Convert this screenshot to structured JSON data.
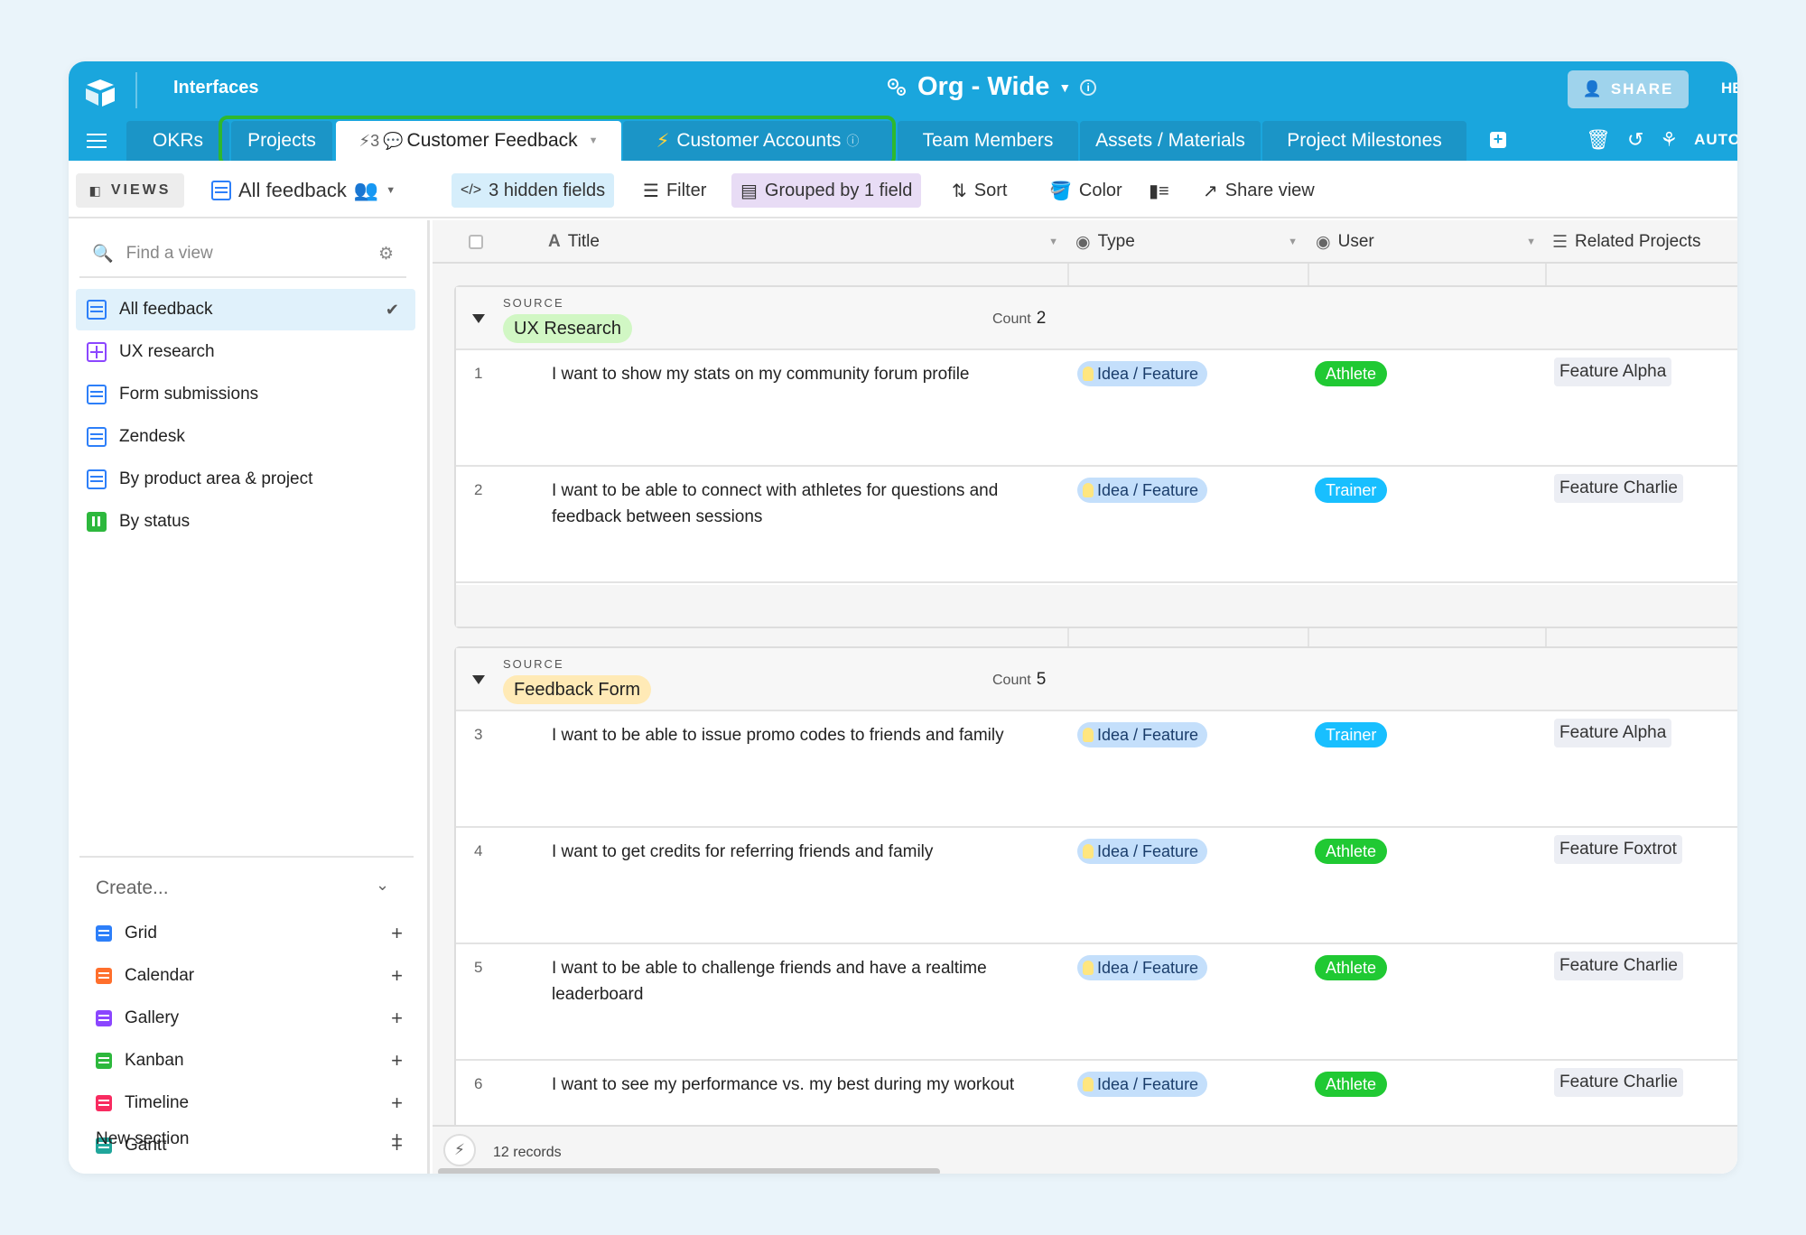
{
  "topbar": {
    "interfaces_label": "Interfaces",
    "base_title": "Org - Wide",
    "share_label": "SHARE",
    "help_label": "HE",
    "autom_label": "AUTOM"
  },
  "tabs": [
    {
      "label": "OKRs"
    },
    {
      "label": "Projects"
    },
    {
      "label": "Customer Feedback",
      "prefix": "⚡3",
      "active": true
    },
    {
      "label": "Customer Accounts"
    },
    {
      "label": "Team Members"
    },
    {
      "label": "Assets / Materials"
    },
    {
      "label": "Project Milestones"
    }
  ],
  "toolbar": {
    "views_label": "VIEWS",
    "current_view": "All feedback",
    "hidden_fields": "3 hidden fields",
    "filter": "Filter",
    "grouped": "Grouped by 1 field",
    "sort": "Sort",
    "color": "Color",
    "share_view": "Share view"
  },
  "sidebar": {
    "find_placeholder": "Find a view",
    "views": [
      {
        "label": "All feedback",
        "icon": "grid-icon",
        "color": "#2d7ff9",
        "active": true
      },
      {
        "label": "UX research",
        "icon": "gallery-icon",
        "color": "#8b46ff"
      },
      {
        "label": "Form submissions",
        "icon": "grid-icon",
        "color": "#2d7ff9"
      },
      {
        "label": "Zendesk",
        "icon": "grid-icon",
        "color": "#2d7ff9"
      },
      {
        "label": "By product area & project",
        "icon": "grid-icon",
        "color": "#2d7ff9"
      },
      {
        "label": "By status",
        "icon": "kanban-icon",
        "color": "#2db83d"
      }
    ],
    "create_label": "Create...",
    "create_items": [
      {
        "label": "Grid",
        "color": "#2d7ff9"
      },
      {
        "label": "Calendar",
        "color": "#ff6f2c"
      },
      {
        "label": "Gallery",
        "color": "#8b46ff"
      },
      {
        "label": "Kanban",
        "color": "#2db83d"
      },
      {
        "label": "Timeline",
        "color": "#f82b60"
      },
      {
        "label": "Gantt",
        "color": "#20a69b"
      }
    ],
    "new_section": "New section"
  },
  "grid": {
    "columns": [
      "Title",
      "Type",
      "User",
      "Related Projects"
    ],
    "groups": [
      {
        "source_label": "SOURCE",
        "value": "UX Research",
        "pill_color": "#d1f7c4",
        "count_label": "Count",
        "count": "2",
        "rows": [
          {
            "num": "1",
            "title": "I want to show my stats on my community forum profile",
            "type": "Idea / Feature",
            "user": "Athlete",
            "user_color": "#20c933",
            "project": "Feature Alpha"
          },
          {
            "num": "2",
            "title": "I want to be able to connect with athletes for questions and feedback between sessions",
            "type": "Idea / Feature",
            "user": "Trainer",
            "user_color": "#18bfff",
            "project": "Feature Charlie"
          }
        ]
      },
      {
        "source_label": "SOURCE",
        "value": "Feedback Form",
        "pill_color": "#ffeab6",
        "count_label": "Count",
        "count": "5",
        "rows": [
          {
            "num": "3",
            "title": "I want to be able to issue promo codes to friends and family",
            "type": "Idea / Feature",
            "user": "Trainer",
            "user_color": "#18bfff",
            "project": "Feature Alpha"
          },
          {
            "num": "4",
            "title": "I want to get credits for referring friends and family",
            "type": "Idea / Feature",
            "user": "Athlete",
            "user_color": "#20c933",
            "project": "Feature Foxtrot"
          },
          {
            "num": "5",
            "title": "I want to be able to challenge friends and have a realtime leaderboard",
            "type": "Idea / Feature",
            "user": "Athlete",
            "user_color": "#20c933",
            "project": "Feature Charlie"
          },
          {
            "num": "6",
            "title": "I want to see my performance vs. my best during my workout",
            "type": "Idea / Feature",
            "user": "Athlete",
            "user_color": "#20c933",
            "project": "Feature Charlie"
          }
        ]
      }
    ],
    "records": "12 records"
  }
}
